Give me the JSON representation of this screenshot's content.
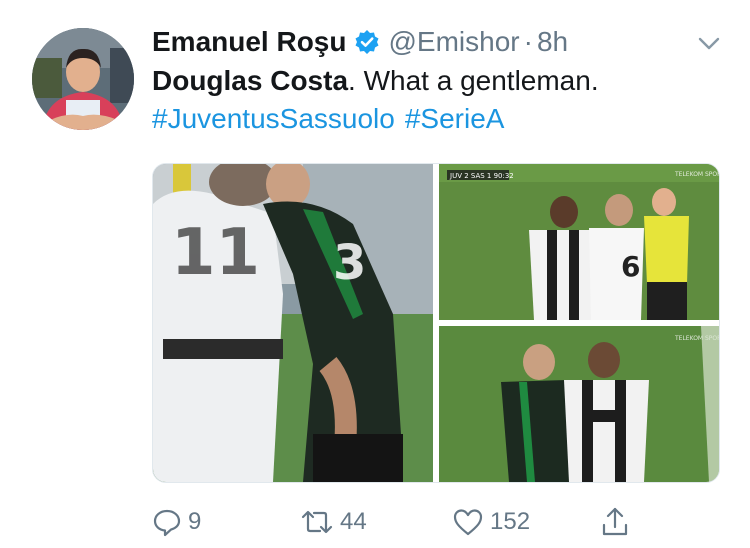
{
  "tweet": {
    "author": {
      "display_name": "Emanuel Roşu",
      "handle": "@Emishor",
      "verified": true,
      "avatar_icon": "person-avatar"
    },
    "separator": "·",
    "timestamp": "8h",
    "text": {
      "bold": "Douglas Costa",
      "rest": ". What a gentleman."
    },
    "hashtags": [
      "#JuventusSassuolo",
      "#SerieA"
    ],
    "media": [
      {
        "kind": "photo",
        "icon": "football-photo"
      },
      {
        "kind": "photo",
        "icon": "football-photo",
        "scoreboard": "JUV 2 SAS 1 90:32",
        "watermark": "TELEKOM SPORT 4"
      },
      {
        "kind": "photo",
        "icon": "football-photo",
        "watermark": "TELEKOM SPORT 4"
      }
    ],
    "actions": {
      "reply": {
        "icon": "reply-icon",
        "count": "9"
      },
      "retweet": {
        "icon": "retweet-icon",
        "count": "44"
      },
      "like": {
        "icon": "heart-icon",
        "count": "152"
      },
      "share": {
        "icon": "share-icon"
      }
    },
    "menu_icon": "chevron-down-icon"
  },
  "colors": {
    "link": "#1b95e0",
    "secondary": "#657786",
    "verified": "#1da1f2",
    "primary_text": "#14171a"
  }
}
